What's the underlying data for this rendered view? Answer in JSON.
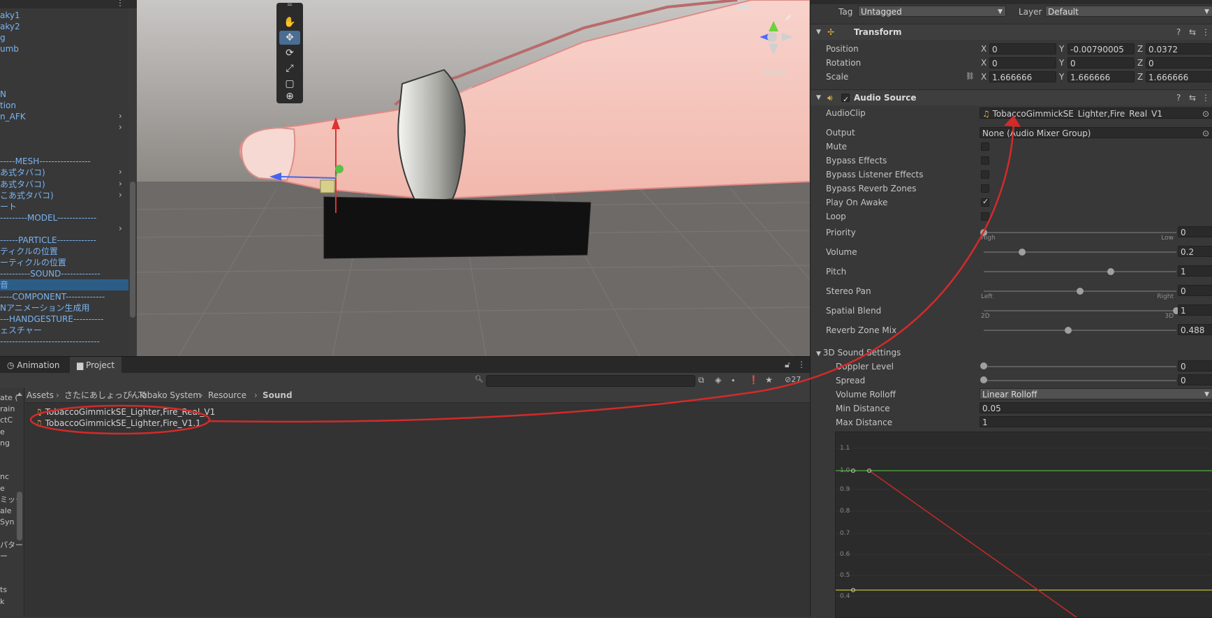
{
  "hierarchy": {
    "items": [
      {
        "label": "aky1",
        "sel": false,
        "chev": false
      },
      {
        "label": "aky2",
        "sel": false,
        "chev": false
      },
      {
        "label": "g",
        "sel": false,
        "chev": false
      },
      {
        "label": "umb",
        "sel": false,
        "chev": false
      },
      {
        "label": "",
        "sel": false,
        "chev": false
      },
      {
        "label": "",
        "sel": false,
        "chev": false
      },
      {
        "label": "",
        "sel": false,
        "chev": false
      },
      {
        "label": "N",
        "sel": false,
        "chev": false
      },
      {
        "label": "tion",
        "sel": false,
        "chev": false
      },
      {
        "label": "n_AFK",
        "sel": false,
        "chev": true
      },
      {
        "label": "",
        "sel": false,
        "chev": true
      },
      {
        "label": "",
        "sel": false,
        "chev": false
      },
      {
        "label": "",
        "sel": false,
        "chev": false
      },
      {
        "label": "-----MESH-----------------",
        "sel": false,
        "chev": false
      },
      {
        "label": "あ式タバコ)",
        "sel": false,
        "chev": true
      },
      {
        "label": "あ式タバコ)",
        "sel": false,
        "chev": true
      },
      {
        "label": "こあ式タバコ)",
        "sel": false,
        "chev": true
      },
      {
        "label": "ート",
        "sel": false,
        "chev": false
      },
      {
        "label": "---------MODEL-------------",
        "sel": false,
        "chev": false
      },
      {
        "label": "",
        "sel": false,
        "chev": true
      },
      {
        "label": "------PARTICLE-------------",
        "sel": false,
        "chev": false
      },
      {
        "label": "ティクルの位置",
        "sel": false,
        "chev": false
      },
      {
        "label": "ーティクルの位置",
        "sel": false,
        "chev": false
      },
      {
        "label": "----------SOUND-------------",
        "sel": false,
        "chev": false
      },
      {
        "label": "音",
        "sel": true,
        "chev": false
      },
      {
        "label": "----COMPONENT-------------",
        "sel": false,
        "chev": false
      },
      {
        "label": "Nアニメーション生成用",
        "sel": false,
        "chev": false
      },
      {
        "label": "---HANDGESTURE----------",
        "sel": false,
        "chev": false
      },
      {
        "label": "ェスチャー",
        "sel": false,
        "chev": false
      },
      {
        "label": "---------------------------------",
        "sel": false,
        "chev": false
      }
    ]
  },
  "scene": {
    "persp_label": "Persp",
    "tools": [
      "hand",
      "move",
      "rotate",
      "scale",
      "rect",
      "transform"
    ]
  },
  "bottom": {
    "tabs": [
      "Animation",
      "Project"
    ],
    "hidden_count": "27",
    "breadcrumb": [
      "Assets",
      "さたにあしょっぴんぐ",
      "Tabako System",
      "Resource",
      "Sound"
    ],
    "assets": [
      "TobaccoGimmickSE_Lighter,Fire_Real_V1",
      "TobaccoGimmickSE_Lighter,Fire_V1.1"
    ],
    "left_items": [
      "ate (",
      "rain",
      "ctC",
      "e",
      "ng",
      "",
      "",
      "nc",
      "e",
      "ミック",
      "ale",
      "Syn",
      "",
      "パター",
      "ー",
      "",
      "",
      "ts",
      "k"
    ]
  },
  "inspector": {
    "tag_label": "Tag",
    "tag_value": "Untagged",
    "layer_label": "Layer",
    "layer_value": "Default",
    "transform": {
      "title": "Transform",
      "rows": [
        {
          "label": "Position",
          "x": "0",
          "y": "-0.00790005",
          "z": "0.0372"
        },
        {
          "label": "Rotation",
          "x": "0",
          "y": "0",
          "z": "0"
        },
        {
          "label": "Scale",
          "x": "1.666666",
          "y": "1.666666",
          "z": "1.666666"
        }
      ]
    },
    "audio": {
      "title": "Audio Source",
      "audioclip_label": "AudioClip",
      "audioclip_value": "TobaccoGimmickSE_Lighter,Fire_Real_V1",
      "output_label": "Output",
      "output_value": "None (Audio Mixer Group)",
      "toggles": [
        {
          "label": "Mute",
          "checked": false
        },
        {
          "label": "Bypass Effects",
          "checked": false
        },
        {
          "label": "Bypass Listener Effects",
          "checked": false
        },
        {
          "label": "Bypass Reverb Zones",
          "checked": false
        },
        {
          "label": "Play On Awake",
          "checked": true
        },
        {
          "label": "Loop",
          "checked": false
        }
      ],
      "sliders": [
        {
          "label": "Priority",
          "value": "0",
          "pos": 0.0,
          "left": "High",
          "right": "Low"
        },
        {
          "label": "Volume",
          "value": "0.2",
          "pos": 0.2,
          "left": "",
          "right": ""
        },
        {
          "label": "Pitch",
          "value": "1",
          "pos": 0.66,
          "left": "",
          "right": ""
        },
        {
          "label": "Stereo Pan",
          "value": "0",
          "pos": 0.5,
          "left": "Left",
          "right": "Right"
        },
        {
          "label": "Spatial Blend",
          "value": "1",
          "pos": 1.0,
          "left": "2D",
          "right": "3D"
        },
        {
          "label": "Reverb Zone Mix",
          "value": "0.488",
          "pos": 0.44,
          "left": "",
          "right": ""
        }
      ],
      "sound3d_label": "3D Sound Settings",
      "doppler_label": "Doppler Level",
      "doppler_value": "0",
      "spread_label": "Spread",
      "spread_value": "0",
      "rolloff_label": "Volume Rolloff",
      "rolloff_value": "Linear Rolloff",
      "min_label": "Min Distance",
      "min_value": "0.05",
      "max_label": "Max Distance",
      "max_value": "1"
    },
    "graph": {
      "y_labels": [
        "1.1",
        "1.0",
        "0.9",
        "0.8",
        "0.7",
        "0.6",
        "0.5",
        "0.4"
      ]
    }
  },
  "colors": {
    "annotation": "#d42a2a",
    "selection": "#2c5d87",
    "link": "#7ab4f2"
  }
}
